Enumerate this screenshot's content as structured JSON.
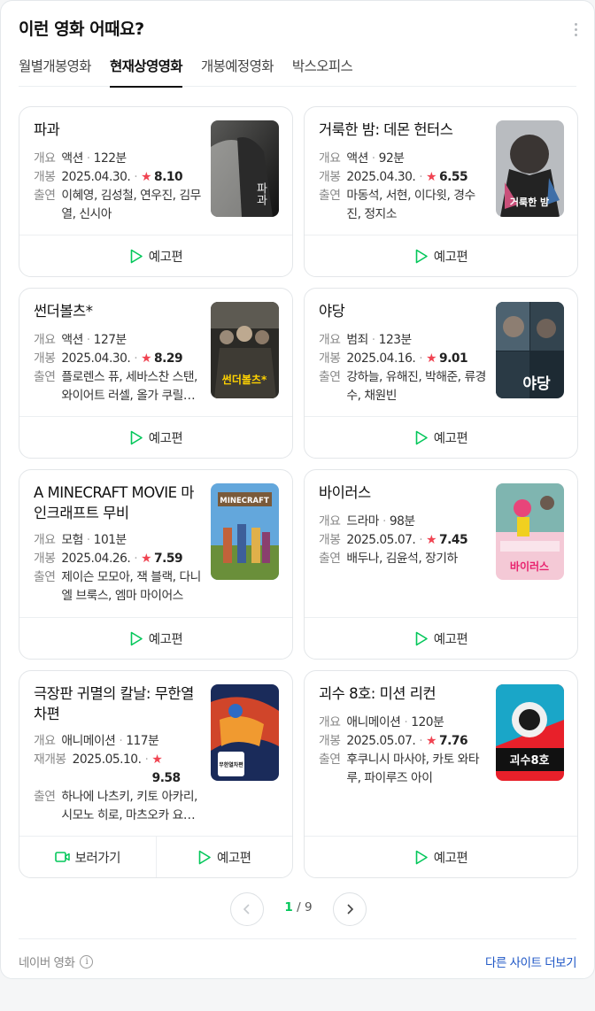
{
  "header": {
    "title": "이런 영화 어때요?"
  },
  "tabs": [
    {
      "label": "월별개봉영화"
    },
    {
      "label": "현재상영영화",
      "active": true
    },
    {
      "label": "개봉예정영화"
    },
    {
      "label": "박스오피스"
    }
  ],
  "labels": {
    "overview": "개요",
    "release": "개봉",
    "rerelease": "재개봉",
    "cast": "출연",
    "trailer": "예고편",
    "watch": "보러가기"
  },
  "movies": [
    {
      "title": "파과",
      "genre": "액션",
      "runtime": "122분",
      "date": "2025.04.30.",
      "rating": "8.10",
      "cast": "이혜영, 김성철, 연우진, 김무열, 신시아",
      "poster_text": "파과"
    },
    {
      "title": "거룩한 밤: 데몬 헌터스",
      "genre": "액션",
      "runtime": "92분",
      "date": "2025.04.30.",
      "rating": "6.55",
      "cast": "마동석, 서현, 이다윗, 경수진, 정지소",
      "poster_text": "거룩한 밤"
    },
    {
      "title": "썬더볼츠*",
      "genre": "액션",
      "runtime": "127분",
      "date": "2025.04.30.",
      "rating": "8.29",
      "cast": "플로렌스 퓨, 세바스찬 스탠, 와이어트 러셀, 올가 쿠릴렌코",
      "poster_text": "썬더볼츠*"
    },
    {
      "title": "야당",
      "genre": "범죄",
      "runtime": "123분",
      "date": "2025.04.16.",
      "rating": "9.01",
      "cast": "강하늘, 유해진, 박해준, 류경수, 채원빈",
      "poster_text": "야당"
    },
    {
      "title": "A MINECRAFT MOVIE 마인크래프트 무비",
      "genre": "모험",
      "runtime": "101분",
      "date": "2025.04.26.",
      "rating": "7.59",
      "cast": "제이슨 모모아, 잭 블랙, 다니엘 브룩스, 엠마 마이어스",
      "poster_text": "MINECRAFT"
    },
    {
      "title": "바이러스",
      "genre": "드라마",
      "runtime": "98분",
      "date": "2025.05.07.",
      "rating": "7.45",
      "cast": "배두나, 김윤석, 장기하",
      "poster_text": "바이러스"
    },
    {
      "title": "극장판 귀멸의 칼날: 무한열차편",
      "genre": "애니메이션",
      "runtime": "117분",
      "date": "2025.05.10.",
      "rating": "9.58",
      "cast": "하나에 나츠키, 키토 아카리, 시모노 히로, 마츠오카 요시츠구",
      "poster_text": "무한열차편"
    },
    {
      "title": "괴수 8호: 미션 리컨",
      "genre": "애니메이션",
      "runtime": "120분",
      "date": "2025.05.07.",
      "rating": "7.76",
      "cast": "후쿠니시 마사야, 카토 와타루, 파이루즈 아이",
      "poster_text": "괴수8호"
    }
  ],
  "pagination": {
    "current": "1",
    "separator": "/",
    "total": "9"
  },
  "footer": {
    "source": "네이버 영화",
    "info_glyph": "i",
    "other_sites": "다른 사이트 더보기"
  },
  "colors": {
    "accent_green": "#03c75a",
    "star_red": "#f04452",
    "link_blue": "#1e56c6"
  }
}
